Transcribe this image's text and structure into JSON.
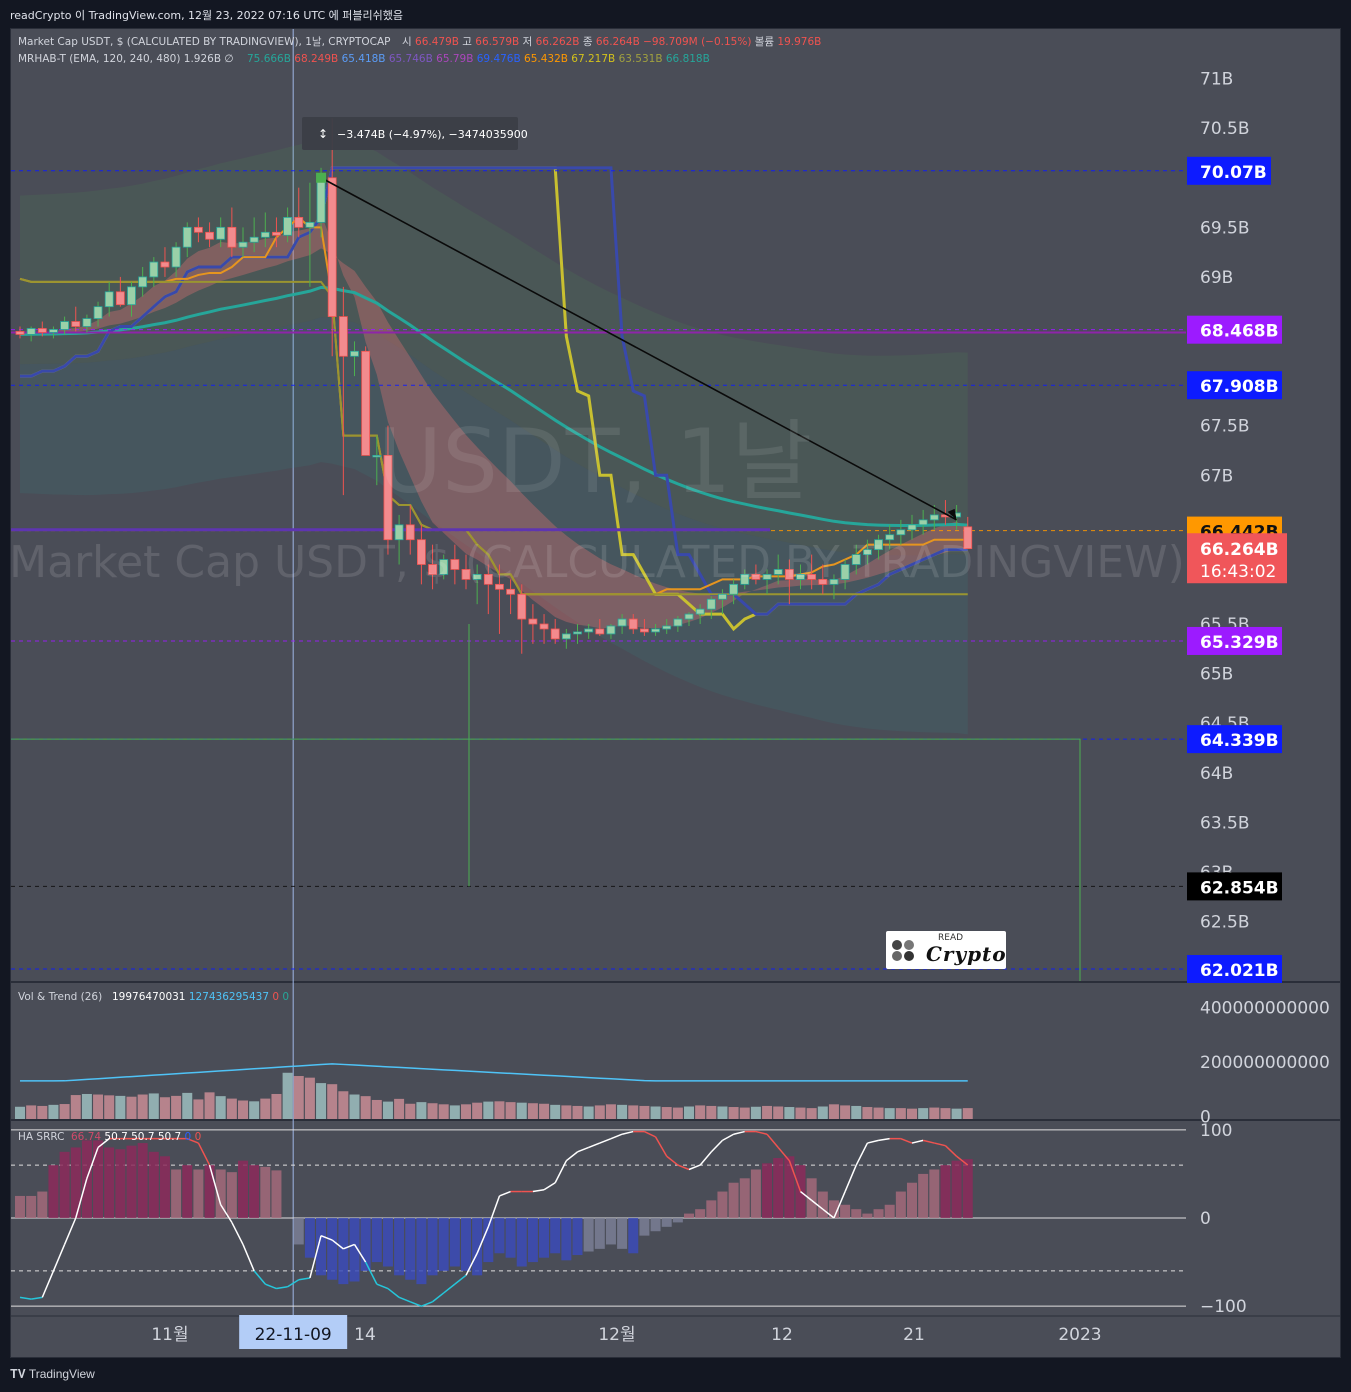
{
  "header": {
    "attribution": "readCrypto 이 TradingView.com, 12월 23, 2022 07:16 UTC 에 퍼블리쉬했음"
  },
  "legend": {
    "main_title": "Market Cap USDT, $ (CALCULATED BY TRADINGVIEW), 1날, CRYPTOCAP",
    "ohlc": [
      "시",
      "66.479B",
      "고",
      "66.579B",
      "저",
      "66.262B",
      "종",
      "66.264B",
      "−98.709M (−0.15%)",
      "볼륨",
      "19.976B"
    ],
    "indicator": "MRHAB-T (EMA, 120, 240, 480)  1.926B  ∅",
    "indicator_values": [
      "75.666B",
      "68.249B",
      "65.418B",
      "65.746B",
      "65.79B",
      "69.476B",
      "65.432B",
      "67.217B",
      "63.531B",
      "66.818B"
    ],
    "indicator_colors": [
      "#26a69a",
      "#ef5350",
      "#5b9cf6",
      "#7e57c2",
      "#ab47bc",
      "#2962ff",
      "#ff9800",
      "#d4c21b",
      "#a0a040",
      "#26a69a"
    ]
  },
  "measure_tooltip": {
    "text": "−3.474B (−4.97%), −3474035900"
  },
  "watermark": {
    "big": "USDT, 1날",
    "small": "Market Cap USDT, $ (CALCULATED BY TRADINGVIEW)"
  },
  "chart_data": [
    {
      "type": "candlestick",
      "pane": "price",
      "price_axis_ticks": [
        "71B",
        "70.5B",
        "69.5B",
        "69B",
        "67.5B",
        "67B",
        "65.5B",
        "65B",
        "64.5B",
        "64B",
        "63.5B",
        "63B",
        "62.5B"
      ],
      "price_tick_values": [
        71,
        70.5,
        69.5,
        69,
        67.5,
        67,
        65.5,
        65,
        64.5,
        64,
        63.5,
        63,
        62.5
      ],
      "ylim": [
        61.9,
        71.5
      ],
      "price_labels": [
        {
          "text": "70.07B",
          "value": 70.07,
          "color": "#0d1bff"
        },
        {
          "text": "68.468B",
          "value": 68.468,
          "color": "#9c1bff"
        },
        {
          "text": "67.908B",
          "value": 67.908,
          "color": "#0d1bff"
        },
        {
          "text": "66.442B",
          "value": 66.442,
          "color": "#ff9800"
        },
        {
          "text": "65.329B",
          "value": 65.329,
          "color": "#9c1bff"
        },
        {
          "text": "64.339B",
          "value": 64.339,
          "color": "#0d1bff"
        },
        {
          "text": "62.854B",
          "value": 62.854,
          "color": "#000000"
        },
        {
          "text": "62.021B",
          "value": 62.021,
          "color": "#0d1bff"
        }
      ],
      "last_price": {
        "text": "66.264B",
        "countdown": "16:43:02",
        "value": 66.264,
        "color": "#f0565a"
      },
      "candles_ohlc": [
        [
          68.45,
          68.5,
          68.38,
          68.42
        ],
        [
          68.42,
          68.5,
          68.35,
          68.48
        ],
        [
          68.48,
          68.55,
          68.4,
          68.44
        ],
        [
          68.44,
          68.5,
          68.38,
          68.47
        ],
        [
          68.47,
          68.6,
          68.42,
          68.55
        ],
        [
          68.55,
          68.7,
          68.45,
          68.5
        ],
        [
          68.5,
          68.62,
          68.44,
          68.58
        ],
        [
          68.58,
          68.75,
          68.5,
          68.7
        ],
        [
          68.7,
          68.95,
          68.6,
          68.85
        ],
        [
          68.85,
          69.0,
          68.7,
          68.72
        ],
        [
          68.72,
          68.95,
          68.6,
          68.9
        ],
        [
          68.9,
          69.1,
          68.8,
          69.0
        ],
        [
          69.0,
          69.2,
          68.9,
          69.15
        ],
        [
          69.15,
          69.3,
          69.0,
          69.1
        ],
        [
          69.1,
          69.35,
          69.0,
          69.3
        ],
        [
          69.3,
          69.55,
          69.2,
          69.5
        ],
        [
          69.5,
          69.6,
          69.35,
          69.45
        ],
        [
          69.45,
          69.55,
          69.3,
          69.38
        ],
        [
          69.38,
          69.6,
          69.3,
          69.5
        ],
        [
          69.5,
          69.7,
          69.2,
          69.3
        ],
        [
          69.3,
          69.5,
          69.2,
          69.35
        ],
        [
          69.35,
          69.6,
          69.25,
          69.4
        ],
        [
          69.4,
          69.65,
          69.3,
          69.45
        ],
        [
          69.45,
          69.6,
          69.3,
          69.42
        ],
        [
          69.42,
          69.7,
          69.35,
          69.6
        ],
        [
          69.6,
          69.9,
          69.4,
          69.5
        ],
        [
          69.5,
          69.95,
          68.9,
          69.55
        ],
        [
          69.55,
          70.1,
          69.4,
          70.0
        ],
        [
          70.0,
          70.6,
          68.2,
          68.6
        ],
        [
          68.6,
          68.9,
          66.8,
          68.2
        ],
        [
          68.2,
          68.35,
          68.0,
          68.25
        ],
        [
          68.25,
          68.3,
          67.2,
          67.2
        ],
        [
          67.2,
          67.4,
          66.9,
          67.2
        ],
        [
          67.2,
          67.5,
          66.2,
          66.35
        ],
        [
          66.35,
          66.6,
          66.1,
          66.5
        ],
        [
          66.5,
          66.7,
          66.2,
          66.35
        ],
        [
          66.35,
          66.5,
          65.9,
          66.1
        ],
        [
          66.1,
          66.3,
          65.85,
          66.0
        ],
        [
          66.0,
          66.2,
          65.95,
          66.15
        ],
        [
          66.15,
          66.3,
          65.9,
          66.05
        ],
        [
          66.05,
          66.2,
          65.85,
          65.95
        ],
        [
          65.95,
          66.1,
          65.7,
          66.0
        ],
        [
          66.0,
          66.1,
          65.6,
          65.9
        ],
        [
          65.9,
          66.1,
          65.4,
          65.85
        ],
        [
          65.85,
          65.95,
          65.6,
          65.8
        ],
        [
          65.8,
          65.9,
          65.2,
          65.55
        ],
        [
          65.55,
          65.7,
          65.3,
          65.5
        ],
        [
          65.5,
          65.6,
          65.3,
          65.45
        ],
        [
          65.45,
          65.55,
          65.3,
          65.35
        ],
        [
          65.35,
          65.45,
          65.25,
          65.4
        ],
        [
          65.4,
          65.5,
          65.3,
          65.42
        ],
        [
          65.42,
          65.5,
          65.35,
          65.45
        ],
        [
          65.45,
          65.55,
          65.38,
          65.4
        ],
        [
          65.4,
          65.5,
          65.35,
          65.48
        ],
        [
          65.48,
          65.6,
          65.4,
          65.55
        ],
        [
          65.55,
          65.6,
          65.4,
          65.45
        ],
        [
          65.45,
          65.55,
          65.38,
          65.42
        ],
        [
          65.42,
          65.5,
          65.38,
          65.45
        ],
        [
          65.45,
          65.55,
          65.4,
          65.48
        ],
        [
          65.48,
          65.58,
          65.42,
          65.55
        ],
        [
          65.55,
          65.62,
          65.48,
          65.6
        ],
        [
          65.6,
          65.7,
          65.5,
          65.65
        ],
        [
          65.65,
          65.78,
          65.55,
          65.75
        ],
        [
          65.75,
          65.85,
          65.6,
          65.8
        ],
        [
          65.8,
          65.95,
          65.7,
          65.9
        ],
        [
          65.9,
          66.05,
          65.85,
          66.0
        ],
        [
          66.0,
          66.1,
          65.9,
          65.95
        ],
        [
          65.95,
          66.05,
          65.8,
          66.0
        ],
        [
          66.0,
          66.2,
          65.9,
          66.05
        ],
        [
          66.05,
          66.15,
          65.7,
          65.95
        ],
        [
          65.95,
          66.1,
          65.85,
          66.0
        ],
        [
          66.0,
          66.2,
          65.85,
          65.95
        ],
        [
          65.95,
          66.1,
          65.8,
          65.9
        ],
        [
          65.9,
          66.0,
          65.75,
          65.95
        ],
        [
          65.95,
          66.15,
          65.85,
          66.1
        ],
        [
          66.1,
          66.3,
          66.0,
          66.2
        ],
        [
          66.2,
          66.35,
          66.1,
          66.25
        ],
        [
          66.25,
          66.4,
          66.15,
          66.35
        ],
        [
          66.35,
          66.5,
          66.25,
          66.4
        ],
        [
          66.4,
          66.55,
          66.3,
          66.45
        ],
        [
          66.45,
          66.6,
          66.35,
          66.5
        ],
        [
          66.5,
          66.65,
          66.4,
          66.55
        ],
        [
          66.55,
          66.7,
          66.45,
          66.6
        ],
        [
          66.6,
          66.75,
          66.5,
          66.58
        ],
        [
          66.58,
          66.7,
          66.45,
          66.62
        ],
        [
          66.48,
          66.58,
          66.26,
          66.26
        ]
      ]
    },
    {
      "type": "bar",
      "pane": "volume",
      "title": "Vol & Trend (26)",
      "values_labels": [
        "19976470031",
        "127436295437",
        "0",
        "0"
      ],
      "value_colors": [
        "#ffffff",
        "#4fc3f7",
        "#ef5350",
        "#26a69a"
      ],
      "axis_ticks": [
        "400000000000",
        "200000000000",
        "0"
      ],
      "axis_tick_values": [
        400,
        200,
        0
      ],
      "ylim": [
        -10,
        490
      ],
      "values": [
        35,
        40,
        38,
        42,
        45,
        78,
        82,
        80,
        77,
        75,
        72,
        80,
        84,
        70,
        75,
        86,
        62,
        88,
        74,
        65,
        58,
        55,
        65,
        82,
        160,
        148,
        142,
        122,
        118,
        92,
        80,
        74,
        60,
        54,
        64,
        46,
        52,
        48,
        44,
        40,
        44,
        50,
        54,
        55,
        52,
        50,
        48,
        46,
        42,
        40,
        38,
        36,
        40,
        44,
        42,
        40,
        38,
        36,
        34,
        32,
        36,
        40,
        38,
        36,
        34,
        32,
        35,
        38,
        36,
        34,
        32,
        30,
        36,
        44,
        40,
        38,
        34,
        32,
        30,
        30,
        28,
        30,
        32,
        30,
        28,
        30
      ],
      "colors": [
        "#c98d95",
        "#9ec0c0"
      ]
    },
    {
      "type": "line",
      "pane": "oscillator",
      "title": "HA SRRC",
      "values_labels": [
        "66.74",
        "50.7",
        "50.7",
        "50.7",
        "0",
        "0"
      ],
      "value_colors": [
        "#d04a6a",
        "#ffffff",
        "#ffffff",
        "#ffffff",
        "#2962ff",
        "#ef5350"
      ],
      "axis_ticks": [
        "100",
        "0",
        "−100"
      ],
      "axis_tick_values": [
        100,
        0,
        -100
      ],
      "ylim": [
        -110,
        110
      ],
      "line": [
        -90,
        -92,
        -90,
        -60,
        -30,
        0,
        45,
        80,
        90,
        90,
        90,
        90,
        90,
        90,
        90,
        90,
        85,
        60,
        15,
        -5,
        -30,
        -60,
        -75,
        -80,
        -78,
        -70,
        -68,
        -20,
        -25,
        -35,
        -30,
        -50,
        -75,
        -80,
        -90,
        -95,
        -100,
        -95,
        -85,
        -75,
        -65,
        -40,
        -10,
        25,
        30,
        30,
        30,
        32,
        40,
        65,
        75,
        80,
        85,
        90,
        95,
        98,
        98,
        92,
        70,
        60,
        55,
        60,
        75,
        88,
        95,
        98,
        98,
        95,
        80,
        65,
        30,
        20,
        10,
        0,
        30,
        60,
        85,
        88,
        90,
        90,
        85,
        88,
        85,
        82,
        70,
        60
      ],
      "hist": [
        25,
        25,
        30,
        60,
        75,
        80,
        88,
        88,
        80,
        78,
        82,
        85,
        75,
        70,
        55,
        60,
        55,
        60,
        55,
        52,
        65,
        60,
        58,
        54,
        0,
        -30,
        -45,
        -65,
        -70,
        -75,
        -72,
        -60,
        -50,
        -55,
        -65,
        -70,
        -75,
        -65,
        -60,
        -55,
        -60,
        -65,
        -50,
        -40,
        -45,
        -55,
        -50,
        -45,
        -40,
        -48,
        -42,
        -38,
        -35,
        -30,
        -35,
        -40,
        -20,
        -15,
        -10,
        -5,
        5,
        10,
        20,
        30,
        40,
        45,
        55,
        62,
        68,
        70,
        60,
        45,
        30,
        20,
        15,
        10,
        5,
        10,
        15,
        30,
        40,
        50,
        55,
        60,
        65,
        66.74
      ],
      "hist_colors": {
        "pos_strong": "#8c2a5a",
        "pos": "#a36a7a",
        "neg": "#3b4bb8",
        "neg_weak": "#7a7f95"
      }
    }
  ],
  "time_axis": {
    "labels": [
      "11월",
      "14",
      "12월",
      "12",
      "21",
      "2023"
    ],
    "cursor_label": "22-11-09"
  },
  "logo": {
    "line1": "READ",
    "line2": "Crypto"
  },
  "footer": {
    "brand": "TradingView"
  }
}
